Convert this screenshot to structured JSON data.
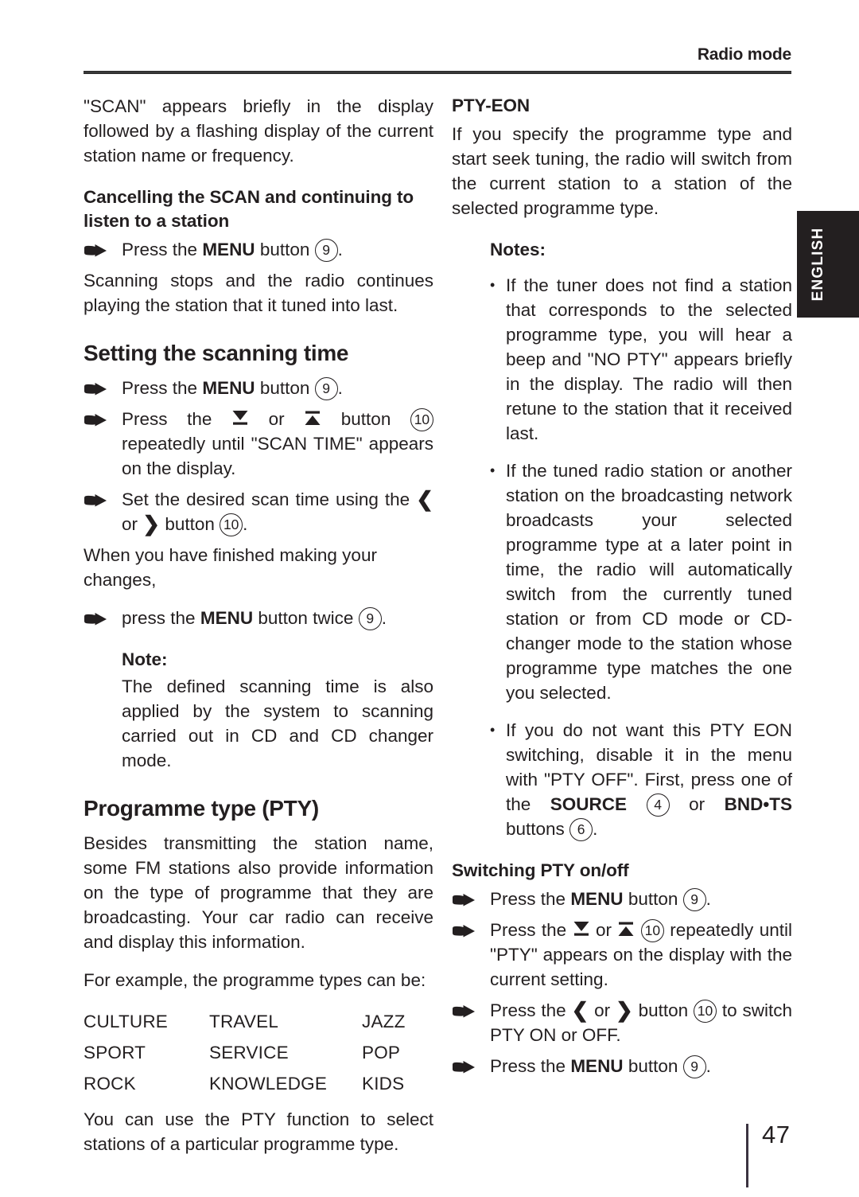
{
  "header": {
    "title": "Radio mode"
  },
  "side_tab": {
    "label": "ENGLISH"
  },
  "footer": {
    "page_number": "47"
  },
  "icons": {
    "hand_bullet": "pointing-hand-icon",
    "arrow_down": "seek-down-arrow-icon",
    "arrow_up": "seek-up-arrow-icon",
    "chevron_left": "chevron-left-icon",
    "chevron_right": "chevron-right-icon"
  },
  "left_column": {
    "intro_paragraph": "\"SCAN\" appears briefly in the display followed by a flashing display of the current station name or frequency.",
    "cancel_scan": {
      "heading": "Cancelling the SCAN and continuing to listen to a station",
      "step_prefix": "Press the",
      "step_bold": "MENU",
      "step_suffix": "button",
      "step_ref": "9",
      "step_end": ".",
      "paragraph": "Scanning stops and the radio continues playing the station that it tuned into last."
    },
    "scanning_time": {
      "heading": "Setting the scanning time",
      "step1": {
        "prefix": "Press the",
        "bold": "MENU",
        "suffix": "button",
        "ref": "9",
        "end": "."
      },
      "step2": {
        "prefix": "Press the",
        "mid": "or",
        "suffix": "button",
        "ref": "10",
        "end": "repeatedly until \"SCAN TIME\" appears on the display."
      },
      "step3": {
        "prefix": "Set the desired scan time using the",
        "mid": "or",
        "suffix": "button",
        "ref": "10",
        "end": "."
      },
      "paragraph": "When you have finished making your changes,",
      "step4": {
        "prefix": "press the",
        "bold": "MENU",
        "suffix": "button twice",
        "ref": "9",
        "end": "."
      },
      "note": {
        "title": "Note:",
        "text": "The defined scanning time is also applied by the system to scanning carried out in CD and CD changer mode."
      }
    },
    "programme_type": {
      "heading": "Programme type (PTY)",
      "paragraph1": "Besides transmitting the station name, some FM stations also provide information on the type of programme that they are broadcasting. Your car radio can receive and display this information.",
      "paragraph2": "For example, the programme types can be:",
      "types_rows": [
        [
          "CULTURE",
          "TRAVEL",
          "JAZZ"
        ],
        [
          "SPORT",
          "SERVICE",
          "POP"
        ],
        [
          "ROCK",
          "KNOWLEDGE",
          "KIDS"
        ]
      ],
      "paragraph3": "You can use the PTY function to select stations of a particular programme type."
    }
  },
  "right_column": {
    "pty_eon": {
      "heading": "PTY-EON",
      "paragraph": "If you specify the programme type and start seek tuning, the radio will switch from the current station to a station of the selected programme type.",
      "notes_title": "Notes:",
      "note1": "If the tuner does not find a station that corresponds to the selected programme type, you will hear a beep and \"NO PTY\" appears briefly in the display. The radio will then retune to the station that it received last.",
      "note2": "If the tuned radio station or another station on the broadcasting network broadcasts your selected programme type at a later point in time, the radio will automatically switch from the currently tuned station or from CD mode or CD-changer mode to the station whose programme type matches the one you selected.",
      "note3": {
        "part1": "If you do not want this PTY EON switching, disable it in the menu with \"PTY OFF\". First, press one of the",
        "bold1": "SOURCE",
        "ref1": "4",
        "mid": "or",
        "bold2": "BND•TS",
        "part2": "buttons",
        "ref2": "6",
        "end": "."
      }
    },
    "switching_pty": {
      "heading": "Switching PTY on/off",
      "step1": {
        "prefix": "Press the",
        "bold": "MENU",
        "suffix": "button",
        "ref": "9",
        "end": "."
      },
      "step2": {
        "prefix": "Press the",
        "mid": "or",
        "ref": "10",
        "end": "repeatedly until \"PTY\" appears on the display with the current setting."
      },
      "step3": {
        "prefix": "Press the",
        "mid": "or",
        "suffix": "button",
        "ref": "10",
        "end": "to switch PTY ON or OFF."
      },
      "step4": {
        "prefix": "Press the",
        "bold": "MENU",
        "suffix": "button",
        "ref": "9",
        "end": "."
      }
    }
  }
}
